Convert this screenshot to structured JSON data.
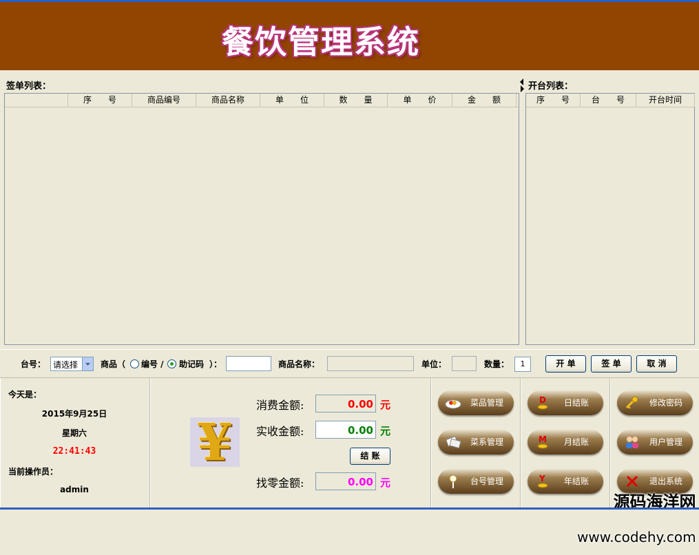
{
  "app": {
    "title": "餐饮管理系统"
  },
  "order_list": {
    "label": "签单列表：",
    "columns": [
      "",
      "序　　号",
      "商品编号",
      "商品名称",
      "单　　位",
      "数　　量",
      "单　　价",
      "金　　额"
    ]
  },
  "table_list": {
    "label": "开台列表：",
    "columns": [
      "序　　号",
      "台　　号",
      "开台时间"
    ]
  },
  "toolbar": {
    "table_no_label": "台号：",
    "table_select_value": "请选择",
    "product_label": "商品（",
    "radio_code_label": "编号 /",
    "radio_mnemonic_label": "助记码",
    "paren_close": "）：",
    "product_input_value": "",
    "product_name_label": "商品名称：",
    "product_name_value": "",
    "unit_label": "单位：",
    "unit_value": "",
    "quantity_label": "数量：",
    "quantity_value": "1",
    "open_button": "开 单",
    "sign_button": "签 单",
    "cancel_button": "取 消"
  },
  "status": {
    "today_label": "今天是：",
    "date": "2015年9月25日",
    "weekday": "星期六",
    "time": "22:41:43",
    "operator_label": "当前操作员：",
    "operator": "admin"
  },
  "checkout": {
    "consume_label": "消费金额:",
    "consume_value": "0.00",
    "received_label": "实收金额:",
    "received_value": "0.00",
    "checkout_button": "结 账",
    "change_label": "找零金额:",
    "change_value": "0.00",
    "currency": "元",
    "colors": {
      "consume": "#ff0000",
      "received": "#008000",
      "change": "#ff00ff"
    }
  },
  "buttons": {
    "dish_management": "菜品管理",
    "category_management": "菜系管理",
    "table_management": "台号管理",
    "daily_settlement": "日结账",
    "monthly_settlement": "月结账",
    "yearly_settlement": "年结账",
    "change_password": "修改密码",
    "user_management": "用户管理",
    "exit_system": "退出系统"
  },
  "watermark": {
    "line1": "源码海洋网",
    "line2": "www.codehy.com"
  },
  "colors": {
    "header": "#924401",
    "time": "#ff0000"
  }
}
